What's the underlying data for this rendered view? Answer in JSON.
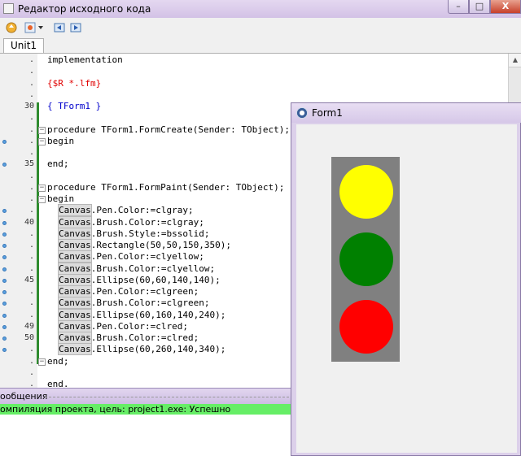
{
  "editor": {
    "title": "Редактор исходного кода",
    "buttons": {
      "minimize": "–",
      "maximize": "□",
      "close": "X"
    },
    "tab": "Unit1"
  },
  "toolbar": {
    "icons": [
      "open-icon",
      "compile-dropdown-icon",
      "navigate-back-icon",
      "navigate-forward-icon"
    ]
  },
  "code": {
    "lines": [
      {
        "num": ".",
        "text": "implementation",
        "style": ""
      },
      {
        "num": ".",
        "text": "",
        "style": ""
      },
      {
        "num": ".",
        "text": "{$R *.lfm}",
        "style": "red"
      },
      {
        "num": ".",
        "text": "",
        "style": ""
      },
      {
        "num": "30",
        "text": "{ TForm1 }",
        "style": "blue"
      },
      {
        "num": ".",
        "text": "",
        "style": ""
      },
      {
        "num": ".",
        "text": "procedure TForm1.FormCreate(Sender: TObject);",
        "style": ""
      },
      {
        "num": ".",
        "text": "begin",
        "style": ""
      },
      {
        "num": ".",
        "text": "",
        "style": ""
      },
      {
        "num": "35",
        "text": "end;",
        "style": ""
      },
      {
        "num": ".",
        "text": "",
        "style": ""
      },
      {
        "num": ".",
        "text": "procedure TForm1.FormPaint(Sender: TObject);",
        "style": ""
      },
      {
        "num": ".",
        "text": "begin",
        "style": ""
      },
      {
        "num": ".",
        "text": "Canvas.Pen.Color:=clgray;",
        "style": ""
      },
      {
        "num": "40",
        "text": "Canvas.Brush.Color:=clgray;",
        "style": ""
      },
      {
        "num": ".",
        "text": "Canvas.Brush.Style:=bssolid;",
        "style": ""
      },
      {
        "num": ".",
        "text": "Canvas.Rectangle(50,50,150,350);",
        "style": ""
      },
      {
        "num": ".",
        "text": "Canvas.Pen.Color:=clyellow;",
        "style": ""
      },
      {
        "num": ".",
        "text": "Canvas.Brush.Color:=clyellow;",
        "style": ""
      },
      {
        "num": "45",
        "text": "Canvas.Ellipse(60,60,140,140);",
        "style": ""
      },
      {
        "num": ".",
        "text": "Canvas.Pen.Color:=clgreen;",
        "style": ""
      },
      {
        "num": ".",
        "text": "Canvas.Brush.Color:=clgreen;",
        "style": ""
      },
      {
        "num": ".",
        "text": "Canvas.Ellipse(60,160,140,240);",
        "style": ""
      },
      {
        "num": "49",
        "text": "Canvas.Pen.Color:=clred;",
        "style": ""
      },
      {
        "num": "50",
        "text": "Canvas.Brush.Color:=clred;",
        "style": ""
      },
      {
        "num": ".",
        "text": "Canvas.Ellipse(60,260,140,340);",
        "style": ""
      },
      {
        "num": ".",
        "text": "end;",
        "style": ""
      },
      {
        "num": ".",
        "text": "",
        "style": ""
      },
      {
        "num": ".",
        "text": "end.",
        "style": ""
      }
    ]
  },
  "messages": {
    "title": "ообщения",
    "line": "омпиляция проекта, цель: project1.exe: Успешно",
    "line_color": "#66ee66"
  },
  "form": {
    "title": "Form1",
    "traffic_light": {
      "body_color": "#808080",
      "lamps": [
        "#ffff00",
        "#008000",
        "#ff0000"
      ]
    }
  }
}
